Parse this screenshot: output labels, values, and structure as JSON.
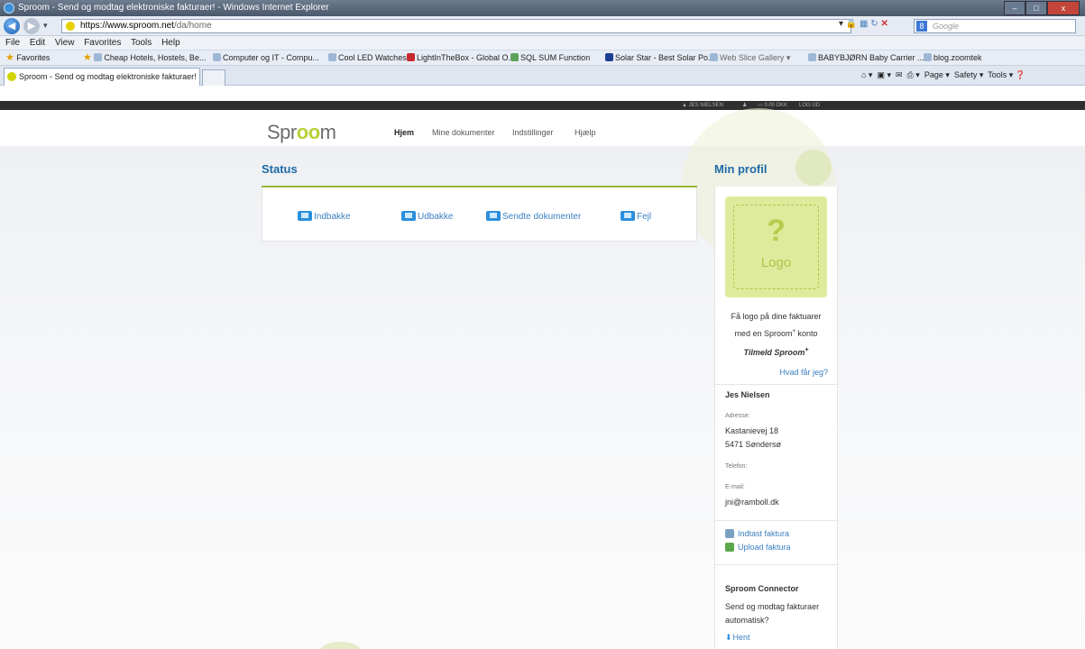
{
  "window": {
    "title": "Sproom - Send og modtag elektroniske fakturaer! - Windows Internet Explorer",
    "controls": [
      "–",
      "□",
      "x"
    ]
  },
  "address": {
    "url_host": "https://www.sproom.net",
    "url_path": "/da/home",
    "search_placeholder": "Google"
  },
  "menu": [
    "File",
    "Edit",
    "View",
    "Favorites",
    "Tools",
    "Help"
  ],
  "favorites": {
    "label": "Favorites",
    "items": [
      "Cheap Hotels, Hostels, Be...",
      "Computer og IT - Compu...",
      "Cool LED Watches",
      "LightInTheBox - Global O...",
      "SQL SUM Function",
      "Solar Star - Best Solar Po...",
      "Web Slice Gallery ▾",
      "BABYBJØRN Baby Carrier ...",
      "blog.zoomtek"
    ]
  },
  "tab": {
    "label": "Sproom - Send og modtag elektroniske fakturaer!"
  },
  "commandbar": {
    "items": [
      "Page ▾",
      "Safety ▾",
      "Tools ▾"
    ]
  },
  "site_topbar": {
    "user": "JES NIELSEN",
    "balance": "0.00 DKK",
    "logout": "LOG UD"
  },
  "site": {
    "logo_pre": "Spr",
    "logo_oo": "oo",
    "logo_post": "m",
    "nav": [
      "Hjem",
      "Mine dokumenter",
      "Indstillinger",
      "Hjælp"
    ]
  },
  "status": {
    "heading": "Status",
    "links": [
      "Indbakke",
      "Udbakke",
      "Sendte dokumenter",
      "Fejl"
    ]
  },
  "profile": {
    "heading": "Min profil",
    "logo_q": "?",
    "logo_text": "Logo",
    "promo_line1": "Få logo på dine faktuarer",
    "promo_line2": "med en Sproom",
    "promo_sup": "+",
    "promo_line2_end": "konto",
    "signup": "Tilmeld Sproom",
    "signup_sup": "+",
    "hvad": "Hvad får jeg?",
    "name": "Jes Nielsen",
    "address_label": "Adresse:",
    "address_line1": "Kastanievej 18",
    "address_line2": "5471 Søndersø",
    "phone_label": "Telefon:",
    "email_label": "E-mail:",
    "email": "jni@ramboll.dk",
    "link_enter": "Indtast faktura",
    "link_upload": "Upload faktura",
    "connector_heading": "Sproom Connector",
    "connector_text1": "Send og modtag fakturaer",
    "connector_text2": "automatisk?",
    "connector_link": "Hent"
  }
}
